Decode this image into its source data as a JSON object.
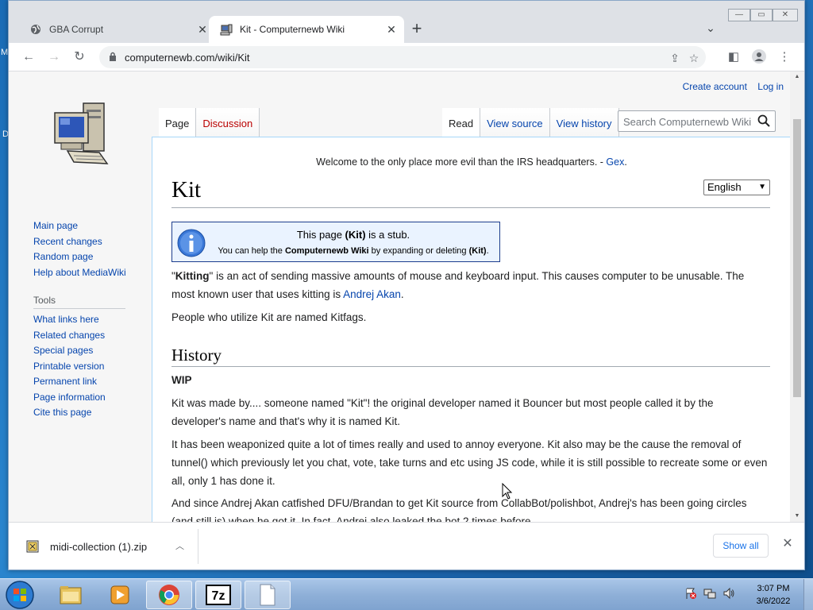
{
  "browser": {
    "tabs": [
      {
        "title": "GBA Corrupt",
        "active": false
      },
      {
        "title": "Kit - Computernewb Wiki",
        "active": true
      }
    ],
    "new_tab_icon": "plus-icon",
    "url": "computernewb.com/wiki/Kit"
  },
  "wiki": {
    "personal": {
      "create_account": "Create account",
      "log_in": "Log in"
    },
    "nav": {
      "page": "Page",
      "discussion": "Discussion",
      "read": "Read",
      "view_source": "View source",
      "view_history": "View history"
    },
    "search_placeholder": "Search Computernewb Wiki",
    "sidebar": {
      "main": [
        "Main page",
        "Recent changes",
        "Random page",
        "Help about MediaWiki"
      ],
      "tools_heading": "Tools",
      "tools": [
        "What links here",
        "Related changes",
        "Special pages",
        "Printable version",
        "Permanent link",
        "Page information",
        "Cite this page"
      ]
    },
    "site_notice": {
      "text": "Welcome to the only place more evil than the IRS headquarters. - ",
      "link": "Gex",
      "suffix": "."
    },
    "title": "Kit",
    "language": "English",
    "stub": {
      "l1_a": "This page ",
      "l1_b": "(Kit)",
      "l1_c": " is a stub.",
      "l2_a": "You can help the ",
      "l2_b": "Computernewb Wiki",
      "l2_c": " by expanding or deleting ",
      "l2_d": "(Kit)",
      "l2_e": "."
    },
    "p1": {
      "a": "\"",
      "b": "Kitting",
      "c": "\" is an act of sending massive amounts of mouse and keyboard input. This causes computer to be unusable. The most known user that uses kitting is ",
      "link": "Andrej Akan",
      "d": "."
    },
    "p2": "People who utilize Kit are named Kitfags.",
    "h2": "History",
    "wip": "WIP",
    "p3": "Kit was made by.... someone named \"Kit\"! the original developer named it Bouncer but most people called it by the developer's name and that's why it is named Kit.",
    "p4": "It has been weaponized quite a lot of times really and used to annoy everyone. Kit also may be the cause the removal of tunnel() which previously let you chat, vote, take turns and etc using JS code, while it is still possible to recreate some or even all, only 1 has done it.",
    "p5": "And since Andrej Akan catfished DFU/Brandan to get Kit source from CollabBot/polishbot, Andrej's has been going circles (and still is) when he got it. In fact, Andrej also leaked the bot 2 times before"
  },
  "download_bar": {
    "file": "midi-collection (1).zip",
    "show_all": "Show all"
  },
  "taskbar": {
    "time": "3:07 PM",
    "date": "3/6/2022"
  },
  "desktop_edge": {
    "a": "M",
    "b": "D"
  }
}
